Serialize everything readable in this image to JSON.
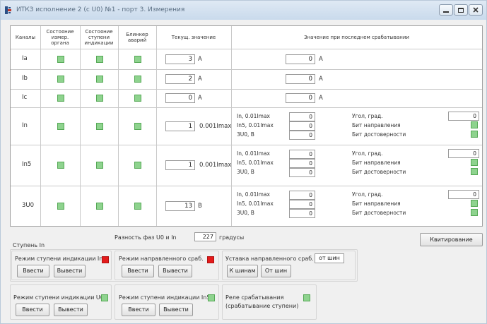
{
  "window": {
    "title": "ИТКЗ исполнение 2 (с U0) №1 - порт 3. Измерения",
    "buttons": {
      "minimize": "minimize-icon",
      "maximize": "maximize-icon",
      "close": "close-icon"
    }
  },
  "table": {
    "headers": {
      "channels": "Каналы",
      "measuring_state": "Состояние измер. органа",
      "stage_state": "Состояние ступени индикации",
      "alarm_blinker": "Блинкер аварий",
      "current_value": "Текущ. значение",
      "last_trip_value": "Значение при последнем срабатывании"
    },
    "rows": [
      {
        "name": "Ia",
        "current": "3",
        "unit": "A",
        "last": "0",
        "last_unit": "A"
      },
      {
        "name": "Ib",
        "current": "2",
        "unit": "A",
        "last": "0",
        "last_unit": "A"
      },
      {
        "name": "Ic",
        "current": "0",
        "unit": "A",
        "last": "0",
        "last_unit": "A"
      },
      {
        "name": "In",
        "current": "1",
        "unit": "0.001Imax",
        "sub": [
          {
            "label": "In, 0.01Imax",
            "value": "0"
          },
          {
            "label": "In5, 0.01Imax",
            "value": "0"
          },
          {
            "label": "3U0, B",
            "value": "0"
          }
        ],
        "right": {
          "angle_label": "Угол, град.",
          "angle": "0",
          "dir_label": "Бит направления",
          "valid_label": "Бит достоверности"
        }
      },
      {
        "name": "In5",
        "current": "1",
        "unit": "0.001Imax",
        "sub": [
          {
            "label": "In, 0.01Imax",
            "value": "0"
          },
          {
            "label": "In5, 0.01Imax",
            "value": "0"
          },
          {
            "label": "3U0, B",
            "value": "0"
          }
        ],
        "right": {
          "angle_label": "Угол, град.",
          "angle": "0",
          "dir_label": "Бит направления",
          "valid_label": "Бит достоверности"
        }
      },
      {
        "name": "3U0",
        "current": "13",
        "unit": "B",
        "sub": [
          {
            "label": "In, 0.01Imax",
            "value": "0"
          },
          {
            "label": "In5, 0.01Imax",
            "value": "0"
          },
          {
            "label": "3U0, B",
            "value": "0"
          }
        ],
        "right": {
          "angle_label": "Угол, град.",
          "angle": "0",
          "dir_label": "Бит направления",
          "valid_label": "Бит достоверности"
        }
      }
    ]
  },
  "phase_diff": {
    "label": "Разность фаз U0 и In",
    "value": "227",
    "unit": "градусы"
  },
  "ack_button": "Квитирование",
  "stage_in": {
    "title": "Ступень In",
    "mode_indication": "Режим ступени индикации In",
    "mode_direction": "Режим направленного сраб.",
    "setpoint_label": "Уставка направленного сраб.",
    "setpoint_value": "от шин",
    "enter": "Ввести",
    "exit": "Вывести",
    "to_bus": "К шинам",
    "from_bus": "От шин"
  },
  "bottom": {
    "mode_u0": "Режим ступени индикации U0",
    "mode_in5": "Режим ступени индикации In5",
    "relay_line1": "Реле срабатывания",
    "relay_line2": "(срабатывание ступени)",
    "enter": "Ввести",
    "exit": "Вывести"
  },
  "colors": {
    "indicator_green": "#8ed38e",
    "indicator_red": "#e41b1b"
  }
}
